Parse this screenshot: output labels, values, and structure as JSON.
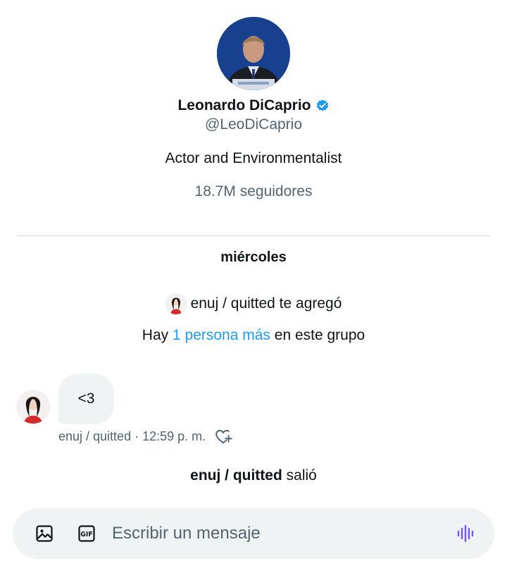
{
  "profile": {
    "name": "Leonardo DiCaprio",
    "handle": "@LeoDiCaprio",
    "bio": "Actor and Environmentalist",
    "followers": "18.7M seguidores",
    "avatar_icon": "profile-photo",
    "verified_icon": "verified-badge-icon",
    "verified_color": "#1d9bf0"
  },
  "conversation": {
    "day_label": "miércoles",
    "added_event": "enuj / quitted te agregó",
    "group_prefix": "Hay",
    "group_link": "1 persona más",
    "group_suffix": "en este grupo",
    "message": {
      "text": "<3",
      "sender": "enuj / quitted",
      "separator": "·",
      "time": "12:59 p. m."
    },
    "left_event_user": "enuj / quitted",
    "left_event_verb": "salió"
  },
  "composer": {
    "placeholder": "Escribir un mensaje",
    "icons": [
      "image-icon",
      "gif-icon",
      "voice-icon"
    ],
    "accent": "#7856ff"
  },
  "colors": {
    "text": "#0f1419",
    "muted": "#536471",
    "link": "#1d9bf0",
    "bubble": "#eff3f4"
  }
}
